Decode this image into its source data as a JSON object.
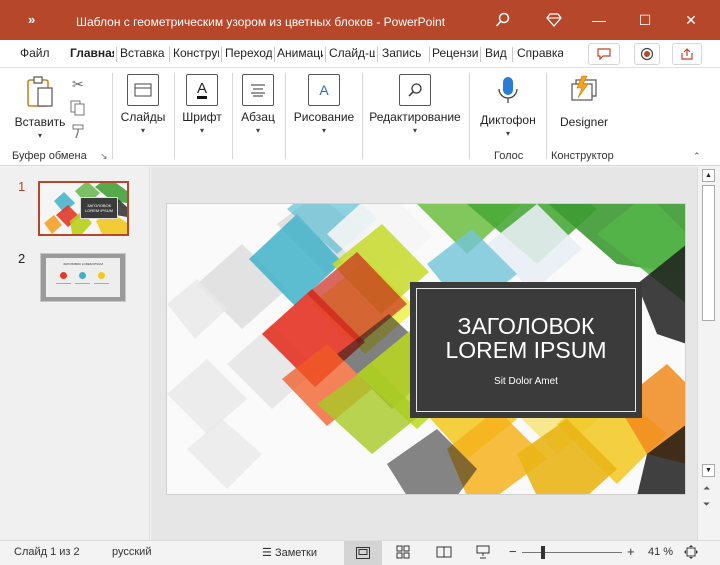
{
  "window": {
    "quick_access": "»",
    "title": "Шаблон с геометрическим узором из цветных блоков  -  PowerPoint",
    "minimize_glyph": "—",
    "maximize_glyph": "☐",
    "close_glyph": "✕"
  },
  "tabs": [
    {
      "label": "Файл"
    },
    {
      "label": "Главная"
    },
    {
      "label": "Вставка"
    },
    {
      "label": "Конструктор"
    },
    {
      "label": "Переходы"
    },
    {
      "label": "Анимация"
    },
    {
      "label": "Слайд-шоу"
    },
    {
      "label": "Запись"
    },
    {
      "label": "Рецензирование"
    },
    {
      "label": "Вид"
    },
    {
      "label": "Справка"
    }
  ],
  "ribbon": {
    "paste": "Вставить",
    "slides": "Слайды",
    "font": "Шрифт",
    "paragraph": "Абзац",
    "drawing": "Рисование",
    "editing": "Редактирование",
    "dictate": "Диктофон",
    "designer": "Designer",
    "groups": {
      "clipboard": "Буфер обмена",
      "voice": "Голос",
      "designer": "Конструктор"
    },
    "font_icon_letter": "A",
    "drawing_icon_letter": "A"
  },
  "thumbnails": [
    {
      "number": "1",
      "title_line1": "ЗАГОЛОВОК",
      "title_line2": "LOREM IPSUM"
    },
    {
      "number": "2",
      "heading": "ЗАГОЛОВОК LOREM IPSUM"
    }
  ],
  "slide": {
    "title_line1": "ЗАГОЛОВОК",
    "title_line2": "LOREM IPSUM",
    "subtitle": "Sit Dolor Amet"
  },
  "status": {
    "slide_info": "Слайд 1 из 2",
    "language": "русский",
    "notes": "Заметки",
    "zoom_minus": "−",
    "zoom_plus": "+",
    "zoom": "41 %",
    "zoom_level": 0.41
  },
  "colors": {
    "accent": "#b7472a",
    "slide_box": "#3b3b3b"
  }
}
